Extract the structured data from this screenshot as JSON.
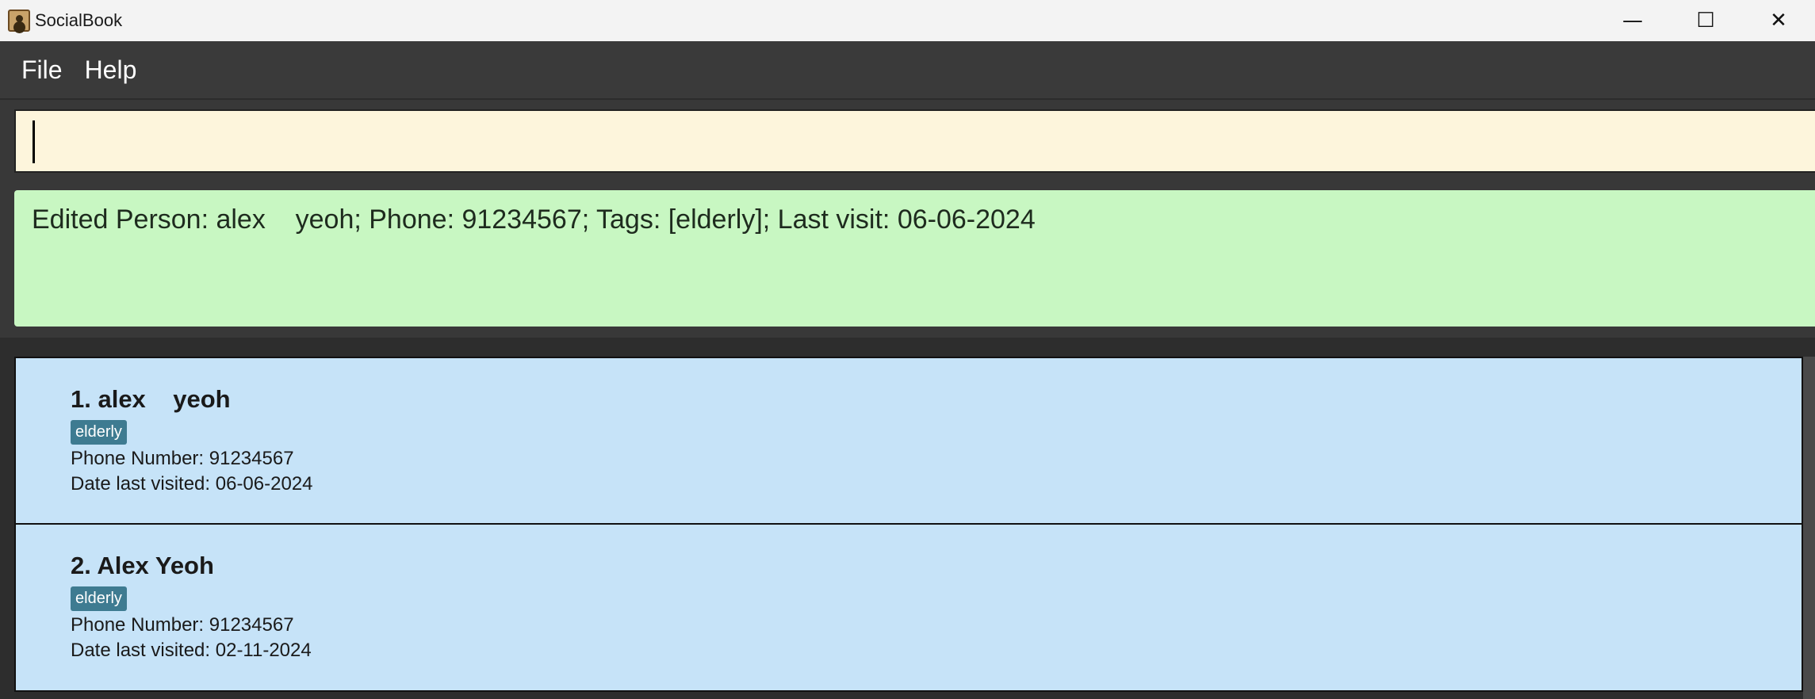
{
  "window": {
    "title": "SocialBook",
    "controls": {
      "minimize": "—",
      "maximize": "☐",
      "close": "✕"
    }
  },
  "menu": {
    "items": [
      {
        "label": "File"
      },
      {
        "label": "Help"
      }
    ]
  },
  "command": {
    "value": ""
  },
  "result": {
    "text": "Edited Person: alex    yeoh; Phone: 91234567; Tags: [elderly]; Last visit: 06-06-2024"
  },
  "persons": [
    {
      "name": "1. alex    yeoh",
      "tag": "elderly",
      "phone": "Phone Number: 91234567",
      "last_visit": "Date last visited: 06-06-2024"
    },
    {
      "name": "2. Alex Yeoh",
      "tag": "elderly",
      "phone": "Phone Number: 91234567",
      "last_visit": "Date last visited: 02-11-2024"
    }
  ],
  "colors": {
    "command_bg": "#fdf5dc",
    "result_bg": "#c8f7c2",
    "card_bg": "#c6e3f8",
    "tag_bg": "#3e7b91",
    "menubar_bg": "#3a3a3a"
  },
  "icons": {
    "app": "address-book-icon"
  }
}
